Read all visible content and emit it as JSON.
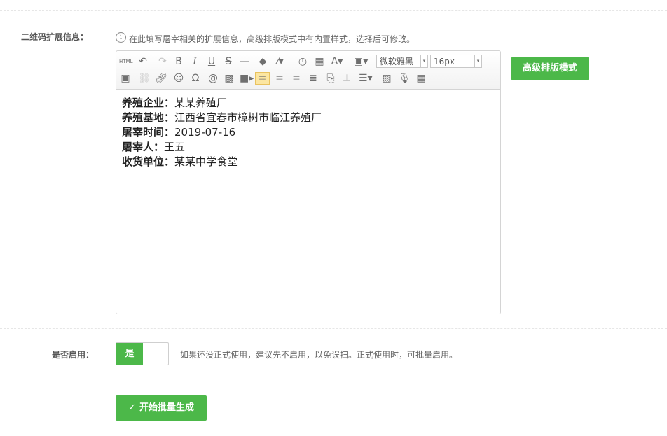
{
  "extended_info": {
    "label": "二维码扩展信息：",
    "hint": "在此填写屠宰相关的扩展信息，高级排版模式中有内置样式，选择后可修改。"
  },
  "editor": {
    "font_family": "微软雅黑",
    "font_size": "16px",
    "toolbar_html": "HTML",
    "lines": [
      {
        "key": "养殖企业：",
        "value": "某某养殖厂"
      },
      {
        "key": "养殖基地：",
        "value": "江西省宜春市樟树市临江养殖厂"
      },
      {
        "key": "屠宰时间：",
        "value": "2019-07-16"
      },
      {
        "key": "屠宰人：",
        "value": "王五"
      },
      {
        "key": "收货单位：",
        "value": "某某中学食堂"
      }
    ]
  },
  "advanced_button": "高级排版模式",
  "enable": {
    "label": "是否启用：",
    "toggle_on": "是",
    "hint": "如果还没正式使用，建议先不启用，以免误扫。正式使用时，可批量启用。"
  },
  "submit": {
    "label": "开始批量生成"
  },
  "colors": {
    "accent": "#4cb849"
  }
}
